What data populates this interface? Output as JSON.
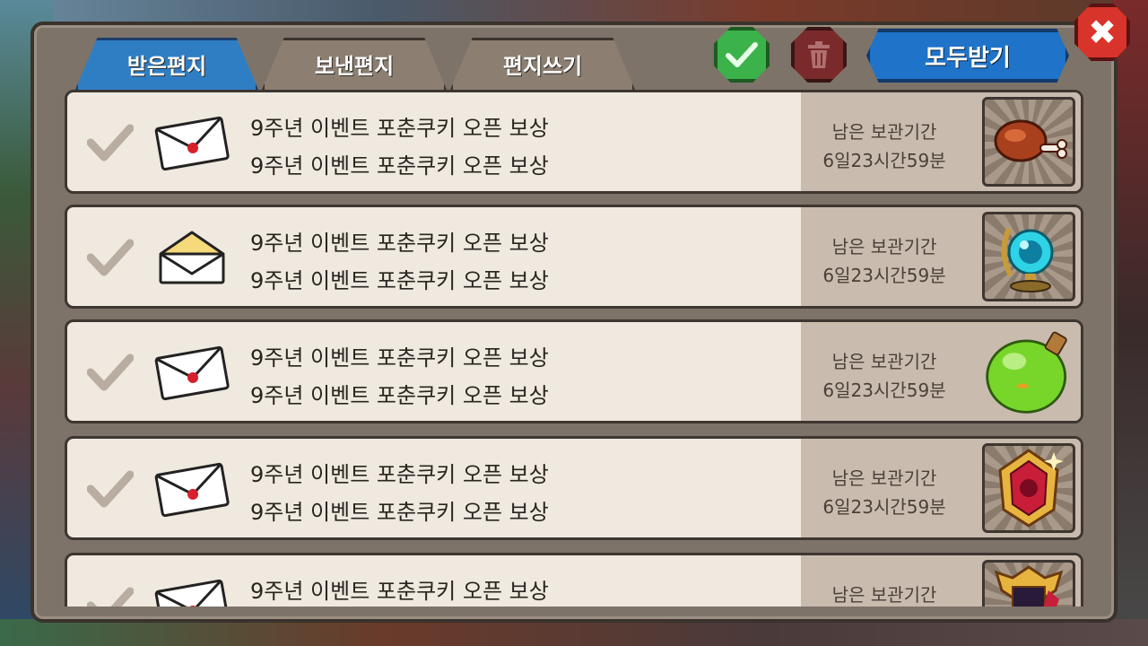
{
  "tabs": [
    {
      "label": "받은편지",
      "active": true
    },
    {
      "label": "보낸편지",
      "active": false
    },
    {
      "label": "편지쓰기",
      "active": false
    }
  ],
  "actions": {
    "receive_all": "모두받기"
  },
  "mails": [
    {
      "title": "9주년 이벤트 포춘쿠키 오픈 보상",
      "subtitle": "9주년 이벤트 포춘쿠키 오픈 보상",
      "keep_label": "남은 보관기간",
      "keep_time": "6일23시간59분",
      "envelope": "closed",
      "reward_icon": "meat-icon"
    },
    {
      "title": "9주년 이벤트 포춘쿠키 오픈 보상",
      "subtitle": "9주년 이벤트 포춘쿠키 오픈 보상",
      "keep_label": "남은 보관기간",
      "keep_time": "6일23시간59분",
      "envelope": "opened",
      "reward_icon": "crystal-orb-icon"
    },
    {
      "title": "9주년 이벤트 포춘쿠키 오픈 보상",
      "subtitle": "9주년 이벤트 포춘쿠키 오픈 보상",
      "keep_label": "남은 보관기간",
      "keep_time": "6일23시간59분",
      "envelope": "closed",
      "reward_icon": "green-potion-icon"
    },
    {
      "title": "9주년 이벤트 포춘쿠키 오픈 보상",
      "subtitle": "9주년 이벤트 포춘쿠키 오픈 보상",
      "keep_label": "남은 보관기간",
      "keep_time": "6일23시간59분",
      "envelope": "closed",
      "reward_icon": "red-gem-icon"
    },
    {
      "title": "9주년 이벤트 포춘쿠키 오픈 보상",
      "subtitle": "",
      "keep_label": "남은 보관기간",
      "keep_time": "",
      "envelope": "closed",
      "reward_icon": "red-crest-icon"
    }
  ],
  "colors": {
    "tab_active": "#2f7ec4",
    "confirm_green": "#3bb34a",
    "trash_red": "#7a2a2a",
    "close_red": "#d9342b"
  }
}
